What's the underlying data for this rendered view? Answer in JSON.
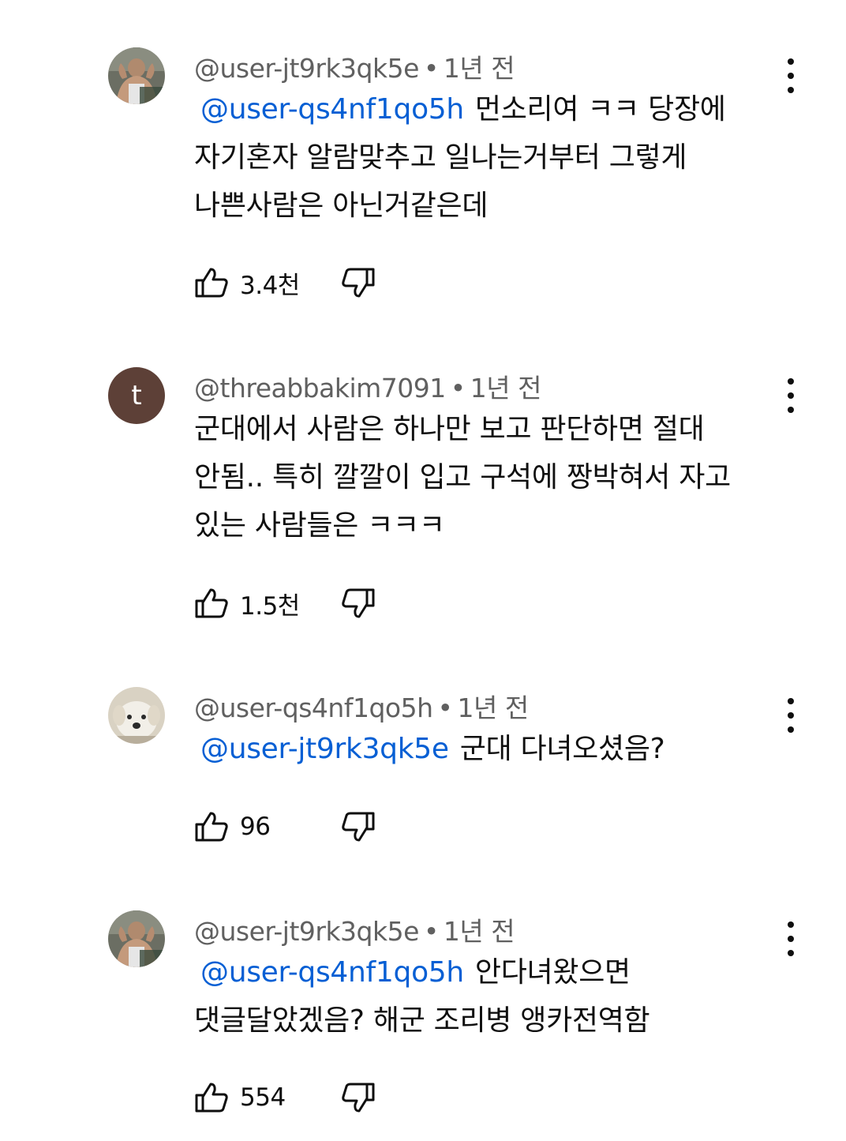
{
  "comments": [
    {
      "handle": "@user-jt9rk3qk5e",
      "time": "1년 전",
      "avatar": "fitness-man-photo",
      "mention": "@user-qs4nf1qo5h",
      "text": "먼소리여 ㅋㅋ 당장에 자기혼자 알람맞추고 일나는거부터 그렇게 나쁜사람은 아닌거같은데",
      "likes": "3.4천"
    },
    {
      "handle": "@threabbakim7091",
      "time": "1년 전",
      "avatar_letter": "t",
      "avatar_color": "#5d4037",
      "mention": "",
      "text": "군대에서 사람은 하나만 보고 판단하면 절대 안됨.. 특히 깔깔이 입고 구석에 짱박혀서 자고 있는 사람들은 ㅋㅋㅋ",
      "likes": "1.5천"
    },
    {
      "handle": "@user-qs4nf1qo5h",
      "time": "1년 전",
      "avatar": "white-puppy-photo",
      "mention": "@user-jt9rk3qk5e",
      "text": "군대 다녀오셨음?",
      "likes": "96"
    },
    {
      "handle": "@user-jt9rk3qk5e",
      "time": "1년 전",
      "avatar": "fitness-man-photo",
      "mention": "@user-qs4nf1qo5h",
      "text": "안다녀왔으면 댓글달았겠음? 해군 조리병 앵카전역함",
      "likes": "554"
    }
  ],
  "colors": {
    "mention": "#065fd4",
    "meta": "#606060",
    "text": "#0f0f0f"
  }
}
